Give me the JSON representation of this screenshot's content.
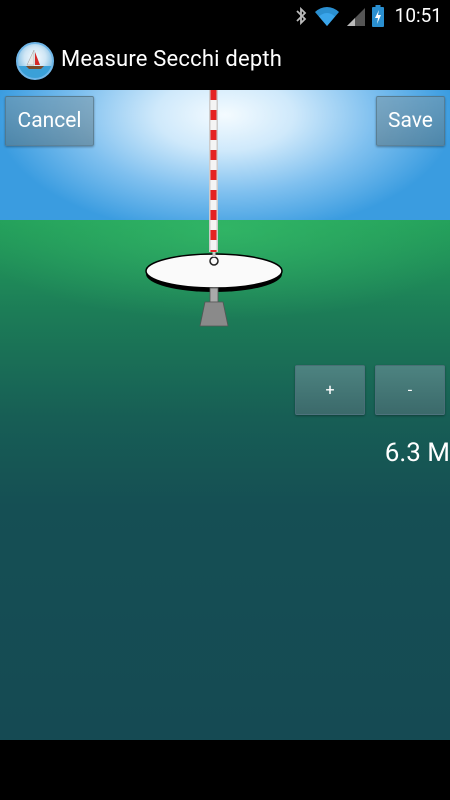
{
  "status_bar": {
    "time": "10:51",
    "icons": [
      "bluetooth-icon",
      "wifi-icon",
      "signal-icon",
      "battery-charging-icon"
    ]
  },
  "action_bar": {
    "title": "Measure Secchi depth",
    "app_icon": "secchi-app-icon"
  },
  "toolbar": {
    "cancel_label": "Cancel",
    "save_label": "Save"
  },
  "depth_controls": {
    "increase_label": "+",
    "decrease_label": "-",
    "depth_value": "6.3 M"
  },
  "colors": {
    "sky": "#7fc0ef",
    "water_top": "#239f5a",
    "water_deep": "#154a53",
    "rope_red": "#e02020"
  }
}
